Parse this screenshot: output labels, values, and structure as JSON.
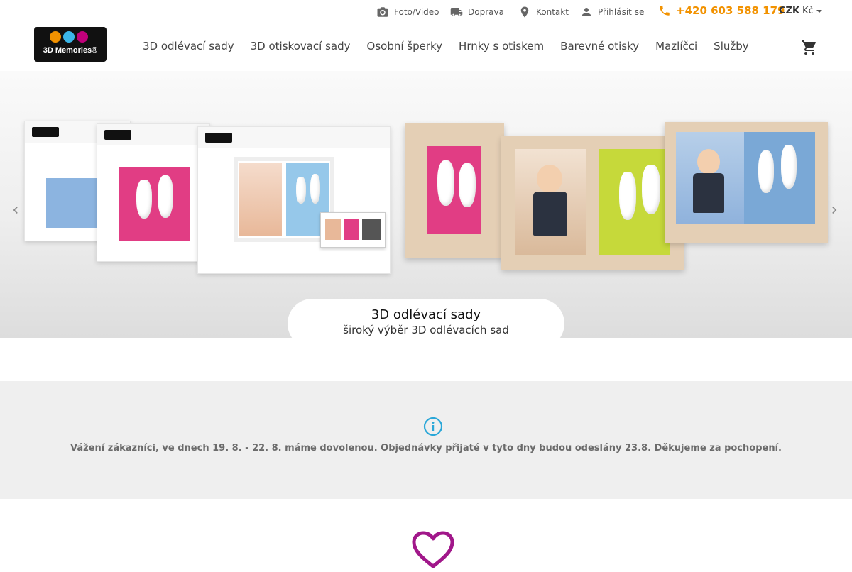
{
  "topbar": {
    "photo_video": "Foto/Video",
    "shipping": "Doprava",
    "contact": "Kontakt",
    "login": "Přihlásit se",
    "phone": "+420 603 588 179",
    "currency_code": "CZK",
    "currency_symbol": "Kč"
  },
  "logo": {
    "text": "3D Memories®",
    "dot_colors": [
      "#f29200",
      "#3bb6e8",
      "#c0007a"
    ]
  },
  "nav": {
    "items": [
      "3D odlévací sady",
      "3D otiskovací sady",
      "Osobní šperky",
      "Hrnky s otiskem",
      "Barevné otisky",
      "Mazlíčci",
      "Služby"
    ]
  },
  "hero": {
    "title": "3D odlévací sady",
    "subtitle": "široký výběr 3D odlévacích sad"
  },
  "notice": {
    "message": "Vážení zákazníci, ve dnech 19. 8. - 22. 8. máme dovolenou. Objednávky přijaté v tyto dny budou odeslány 23.8. Děkujeme za pochopení."
  },
  "colors": {
    "accent": "#f29200",
    "info": "#2aa7d8",
    "heart": "#a1178a"
  }
}
